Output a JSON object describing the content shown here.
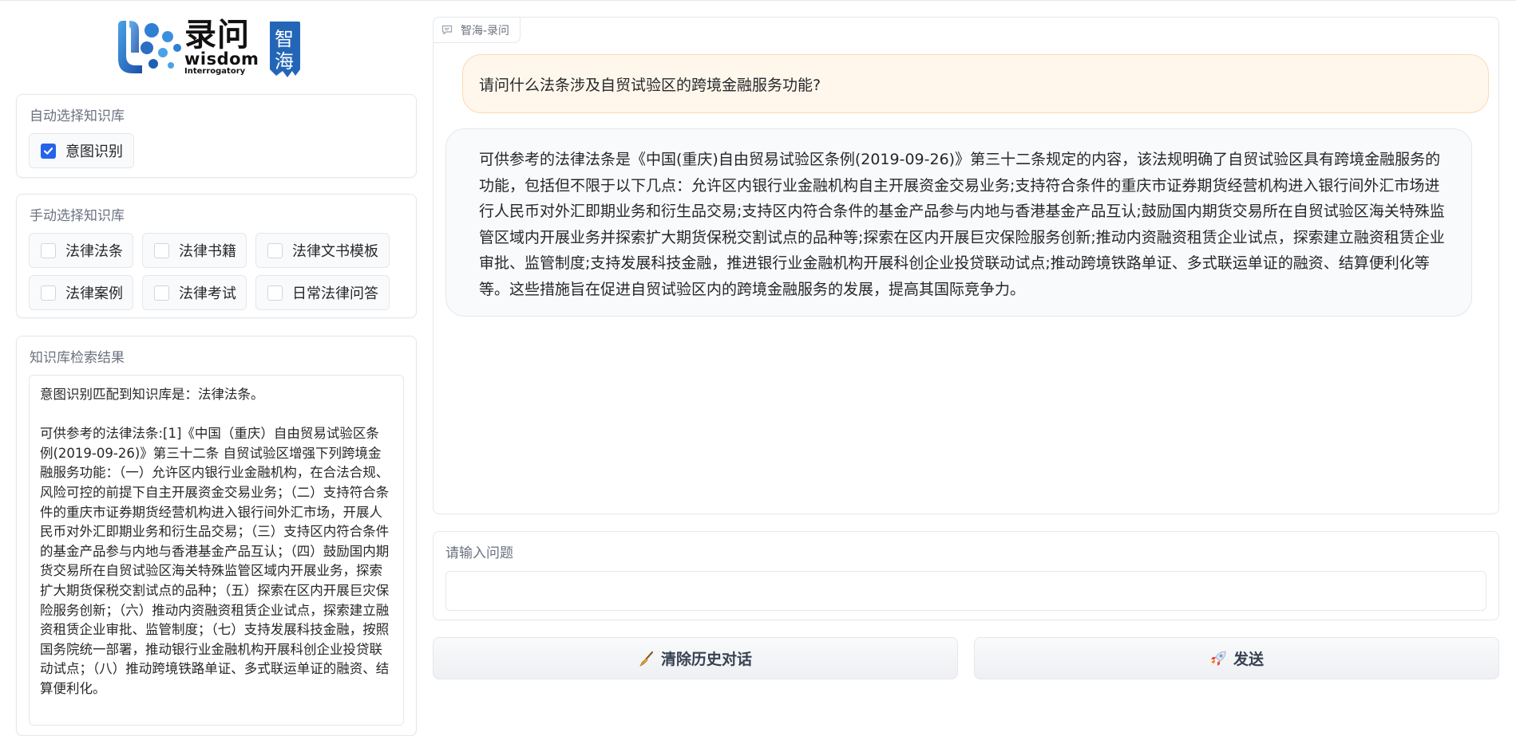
{
  "logo": {
    "cn": "录问",
    "en_line1": "wisdom",
    "en_line2": "Interrogatory",
    "seal": "智海"
  },
  "auto_select": {
    "label": "自动选择知识库",
    "options": [
      {
        "label": "意图识别",
        "checked": true
      }
    ]
  },
  "manual_select": {
    "label": "手动选择知识库",
    "options": [
      {
        "label": "法律法条",
        "checked": false
      },
      {
        "label": "法律书籍",
        "checked": false
      },
      {
        "label": "法律文书模板",
        "checked": false
      },
      {
        "label": "法律案例",
        "checked": false
      },
      {
        "label": "法律考试",
        "checked": false
      },
      {
        "label": "日常法律问答",
        "checked": false
      }
    ]
  },
  "kb_results": {
    "label": "知识库检索结果",
    "line1": "意图识别匹配到知识库是：法律法条。",
    "line2": "可供参考的法律法条:[1]《中国（重庆）自由贸易试验区条例(2019-09-26)》第三十二条 自贸试验区增强下列跨境金融服务功能：（一）允许区内银行业金融机构，在合法合规、风险可控的前提下自主开展资金交易业务；（二）支持符合条件的重庆市证券期货经营机构进入银行间外汇市场，开展人民币对外汇即期业务和衍生品交易；（三）支持区内符合条件的基金产品参与内地与香港基金产品互认；（四）鼓励国内期货交易所在自贸试验区海关特殊监管区域内开展业务，探索扩大期货保税交割试点的品种；（五）探索在区内开展巨灾保险服务创新；（六）推动内资融资租赁企业试点，探索建立融资租赁企业审批、监管制度；（七）支持发展科技金融，按照国务院统一部署，推动银行业金融机构开展科创企业投贷联动试点；（八）推动跨境铁路单证、多式联运单证的融资、结算便利化。"
  },
  "chat": {
    "tab_label": "智海-录问",
    "user_message": "请问什么法条涉及自贸试验区的跨境金融服务功能?",
    "bot_message": "可供参考的法律法条是《中国(重庆)自由贸易试验区条例(2019-09-26)》第三十二条规定的内容，该法规明确了自贸试验区具有跨境金融服务的功能，包括但不限于以下几点：允许区内银行业金融机构自主开展资金交易业务;支持符合条件的重庆市证券期货经营机构进入银行间外汇市场进行人民币对外汇即期业务和衍生品交易;支持区内符合条件的基金产品参与内地与香港基金产品互认;鼓励国内期货交易所在自贸试验区海关特殊监管区域内开展业务并探索扩大期货保税交割试点的品种等;探索在区内开展巨灾保险服务创新;推动内资融资租赁企业试点，探索建立融资租赁企业审批、监管制度;支持发展科技金融，推进银行业金融机构开展科创企业投贷联动试点;推动跨境铁路单证、多式联运单证的融资、结算便利化等等。这些措施旨在促进自贸试验区内的跨境金融服务的发展，提高其国际竞争力。"
  },
  "input": {
    "label": "请输入问题",
    "value": "",
    "placeholder": ""
  },
  "buttons": {
    "clear_label": "清除历史对话",
    "clear_icon": "broom-icon",
    "send_label": "发送",
    "send_icon": "rocket-icon"
  },
  "colors": {
    "accent": "#2563eb",
    "user_bubble_bg": "#fff7ec",
    "user_bubble_border": "#fcd9b0",
    "bot_bubble_bg": "#f8fafc"
  }
}
